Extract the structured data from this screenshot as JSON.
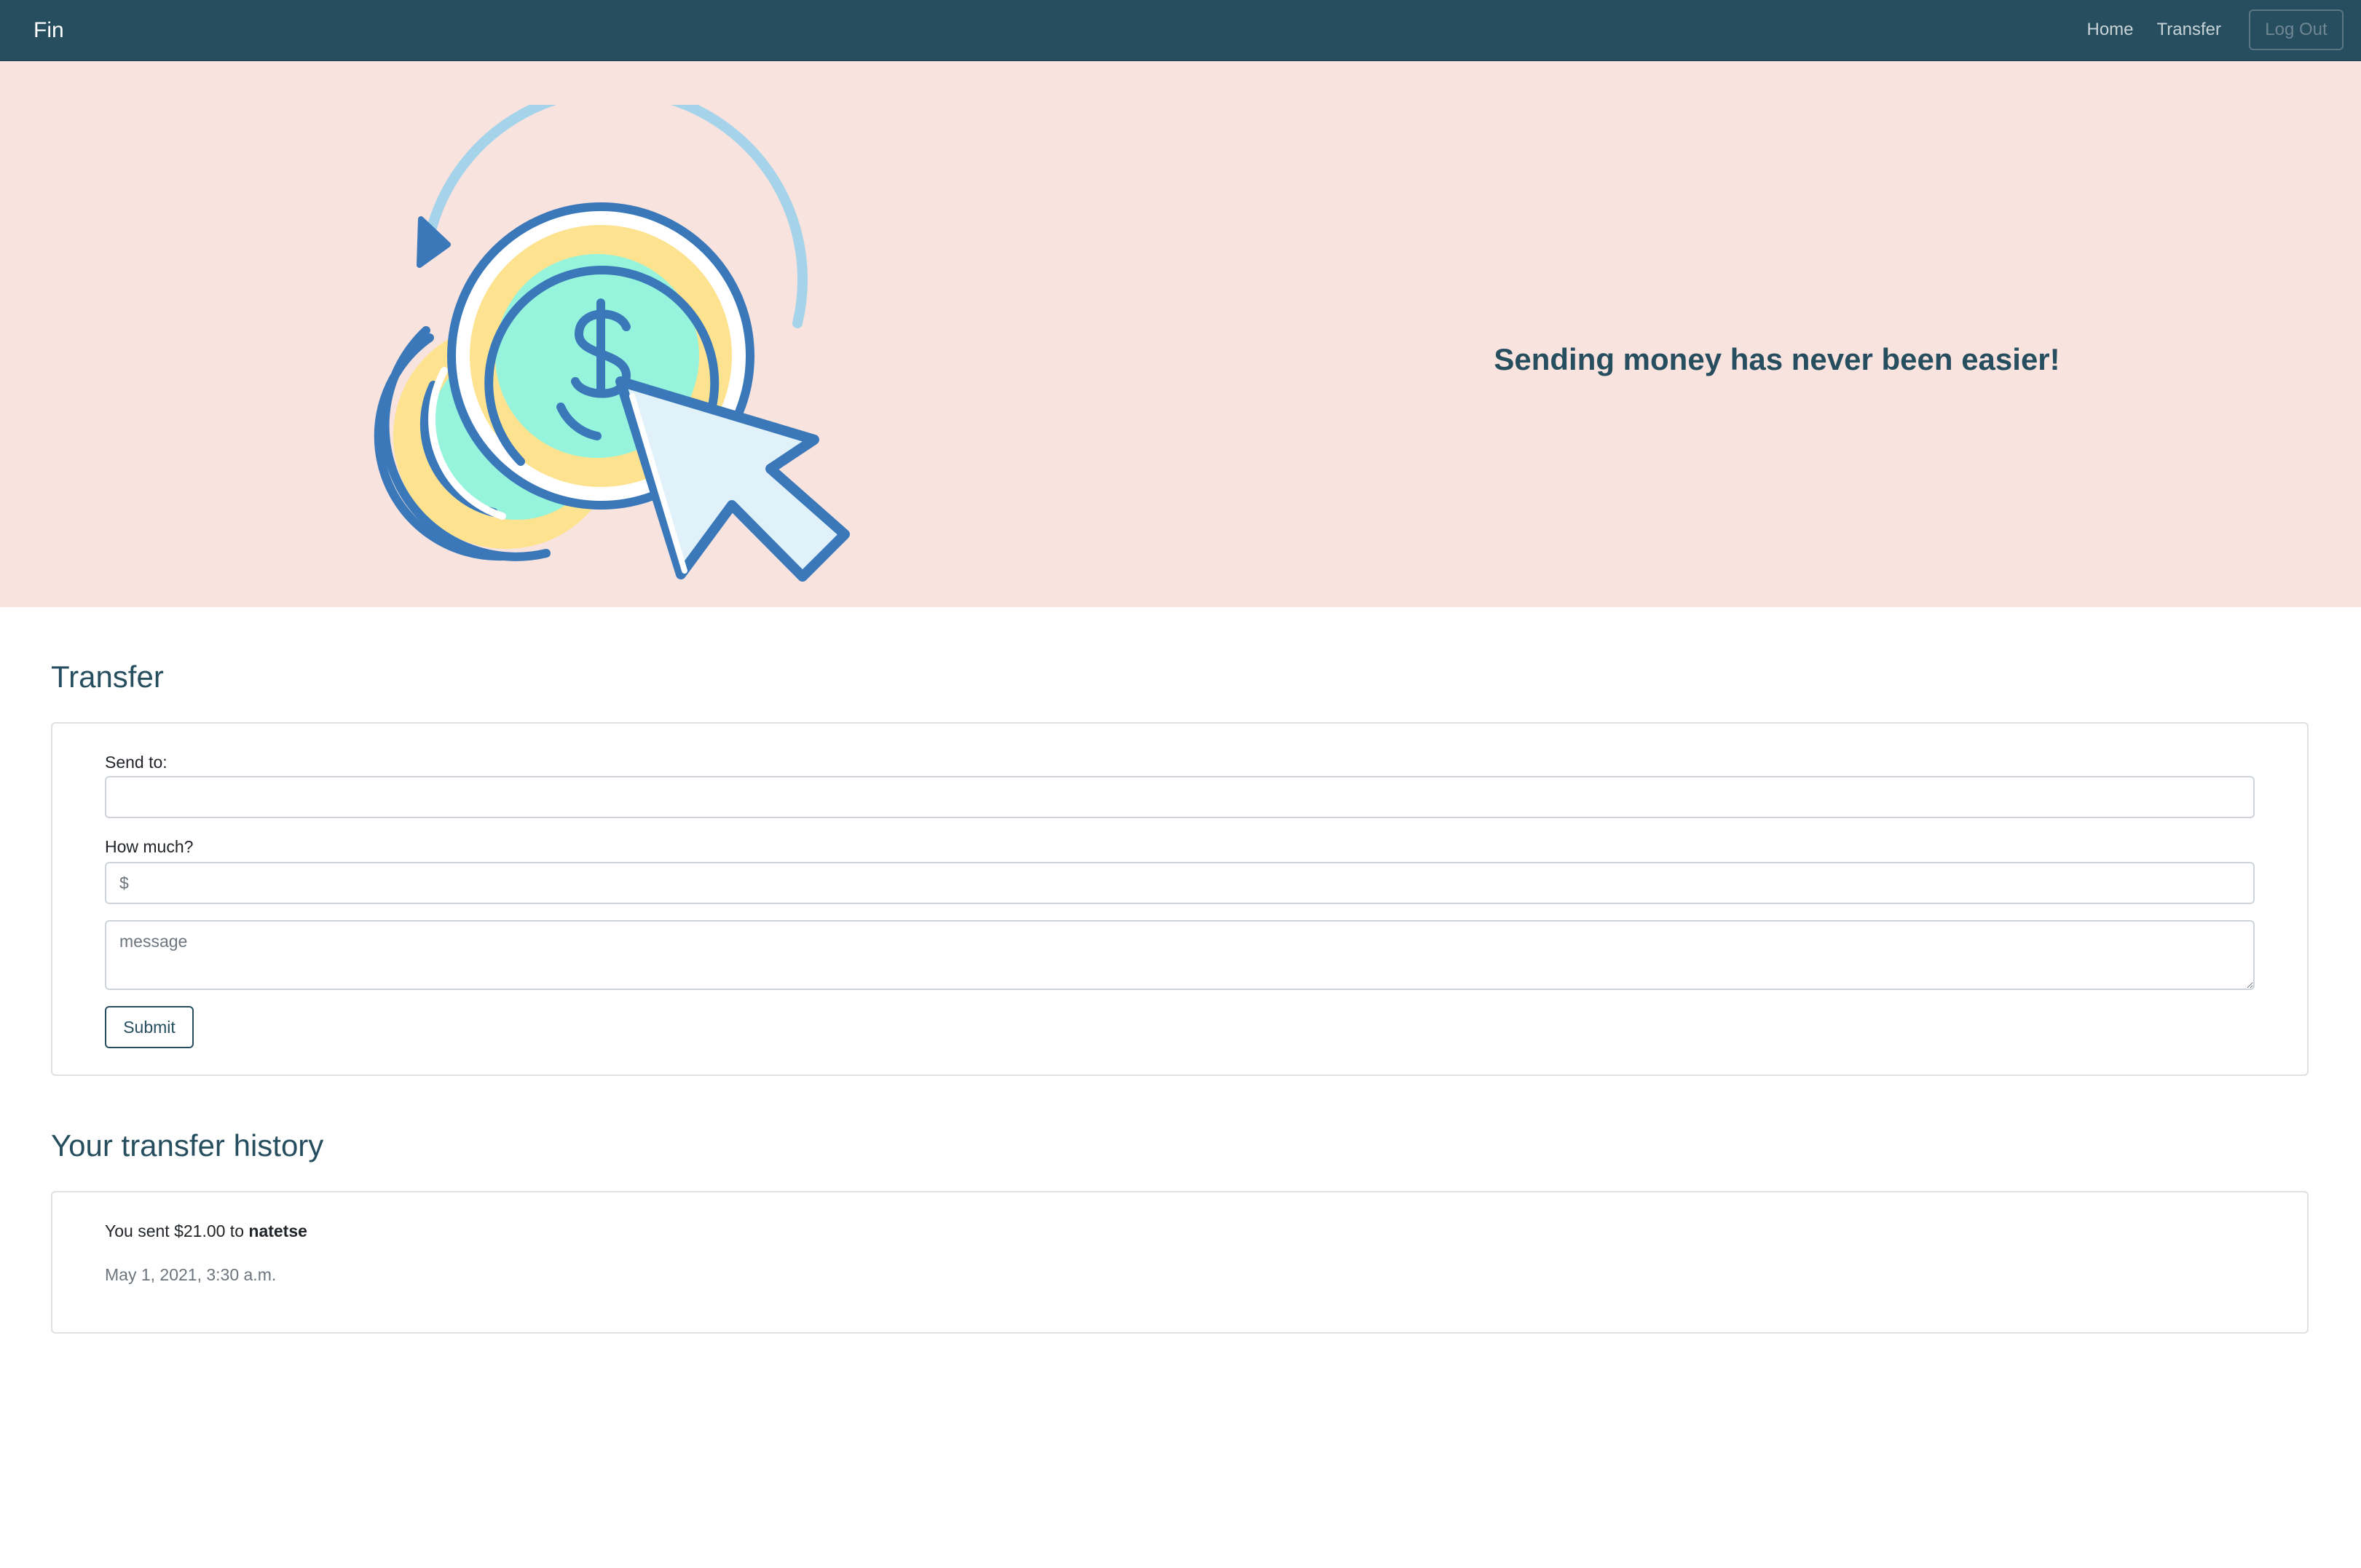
{
  "navbar": {
    "brand": "Fin",
    "links": {
      "home": "Home",
      "transfer": "Transfer"
    },
    "logout_label": "Log Out"
  },
  "hero": {
    "tagline": "Sending money has never been easier!",
    "illustration": "coins-cursor-transfer-icon"
  },
  "transfer": {
    "title": "Transfer",
    "send_to_label": "Send to:",
    "send_to_value": "",
    "amount_label": "How much?",
    "amount_placeholder": "$",
    "message_placeholder": "message",
    "submit_label": "Submit"
  },
  "history": {
    "title": "Your transfer history",
    "entries": [
      {
        "prefix": "You sent $21.00 to ",
        "recipient": "natetse",
        "timestamp": "May 1, 2021, 3:30 a.m."
      }
    ]
  },
  "colors": {
    "navbar": "#264e5f",
    "hero_background": "#f8e3df",
    "accent": "#264e5f",
    "coin_outline": "#3a78b9",
    "coin_face": "#96f4dc",
    "coin_rim": "#fde38f",
    "cursor_fill": "#e1f1f9",
    "arc": "#a5d3ea"
  }
}
